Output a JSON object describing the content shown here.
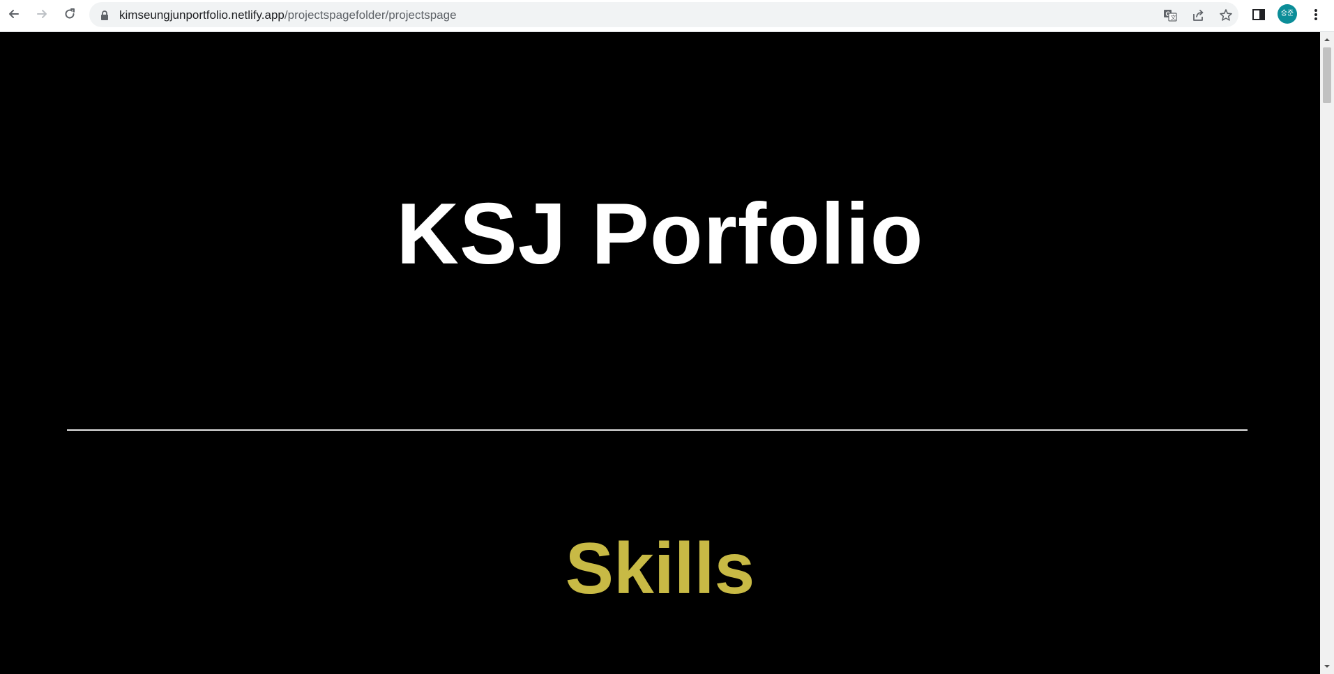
{
  "browser": {
    "url_domain": "kimseungjunportfolio.netlify.app",
    "url_path": "/projectspagefolder/projectspage",
    "avatar_text": "승준",
    "icons": {
      "back": "back-arrow-icon",
      "forward": "forward-arrow-icon",
      "reload": "reload-icon",
      "lock": "lock-icon",
      "translate": "translate-icon",
      "share": "share-icon",
      "bookmark": "star-icon",
      "side_panel": "side-panel-icon",
      "menu": "kebab-menu-icon"
    }
  },
  "page": {
    "title": "KSJ Porfolio",
    "section_heading": "Skills",
    "colors": {
      "background": "#000000",
      "title": "#ffffff",
      "section_heading": "#c8ba45",
      "divider": "#e6e6e6"
    }
  }
}
